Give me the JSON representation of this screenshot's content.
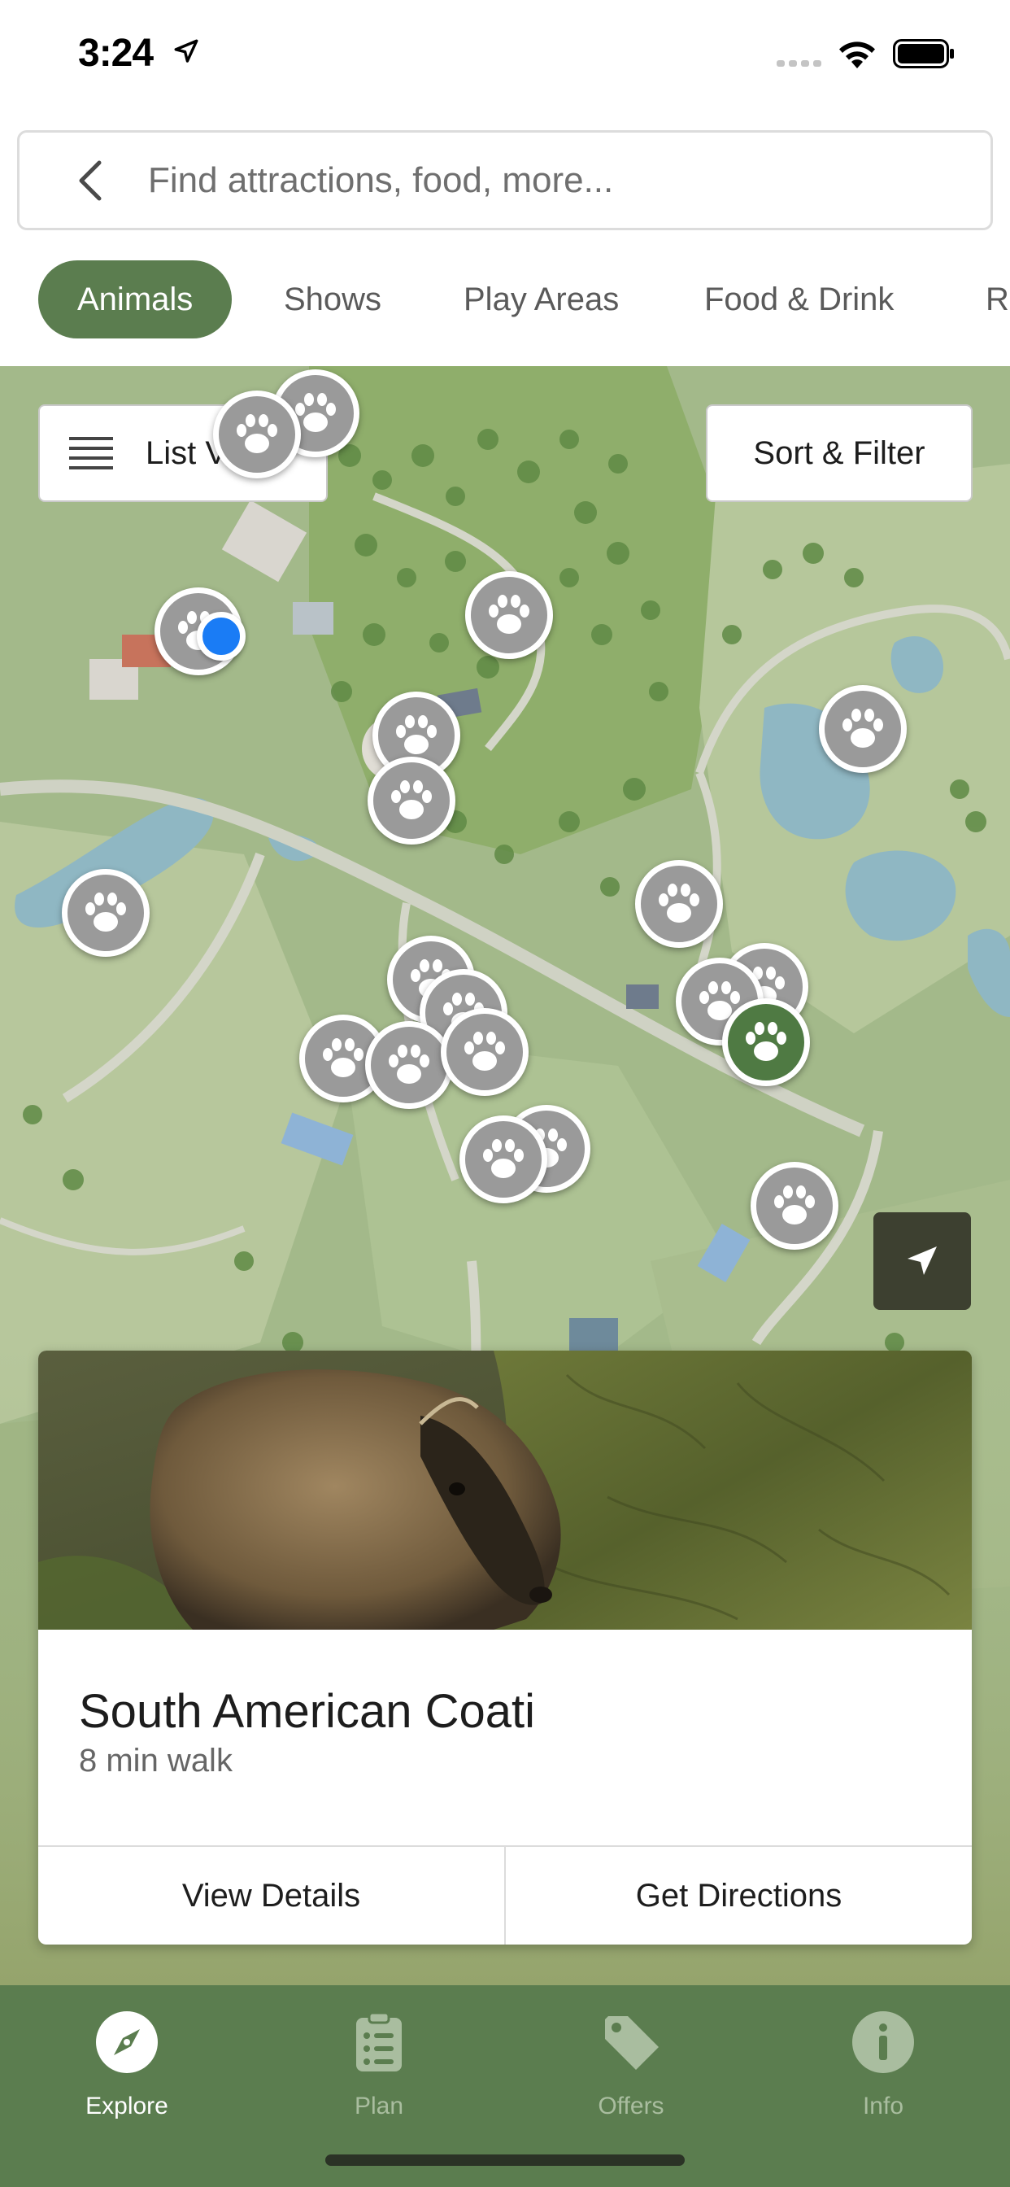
{
  "status_bar": {
    "time": "3:24"
  },
  "search": {
    "placeholder": "Find attractions, food, more..."
  },
  "categories": [
    {
      "label": "Animals",
      "active": true
    },
    {
      "label": "Shows",
      "active": false
    },
    {
      "label": "Play Areas",
      "active": false
    },
    {
      "label": "Food & Drink",
      "active": false
    },
    {
      "label": "Re",
      "active": false
    }
  ],
  "map": {
    "list_view_label": "List View",
    "sort_filter_label": "Sort & Filter",
    "marker_icon": "paw-icon",
    "locate_icon": "navigation-arrow-icon"
  },
  "card": {
    "title": "South American Coati",
    "subtitle": "8 min walk",
    "view_details_label": "View Details",
    "get_directions_label": "Get Directions"
  },
  "tabs": [
    {
      "label": "Explore",
      "icon": "compass-icon",
      "active": true
    },
    {
      "label": "Plan",
      "icon": "clipboard-list-icon",
      "active": false
    },
    {
      "label": "Offers",
      "icon": "tag-icon",
      "active": false
    },
    {
      "label": "Info",
      "icon": "info-icon",
      "active": false
    }
  ],
  "colors": {
    "brand_green": "#5b7d4f",
    "selected_marker": "#4f7a43",
    "marker_gray": "#9a9a9a",
    "user_location_blue": "#1a7cf5"
  }
}
